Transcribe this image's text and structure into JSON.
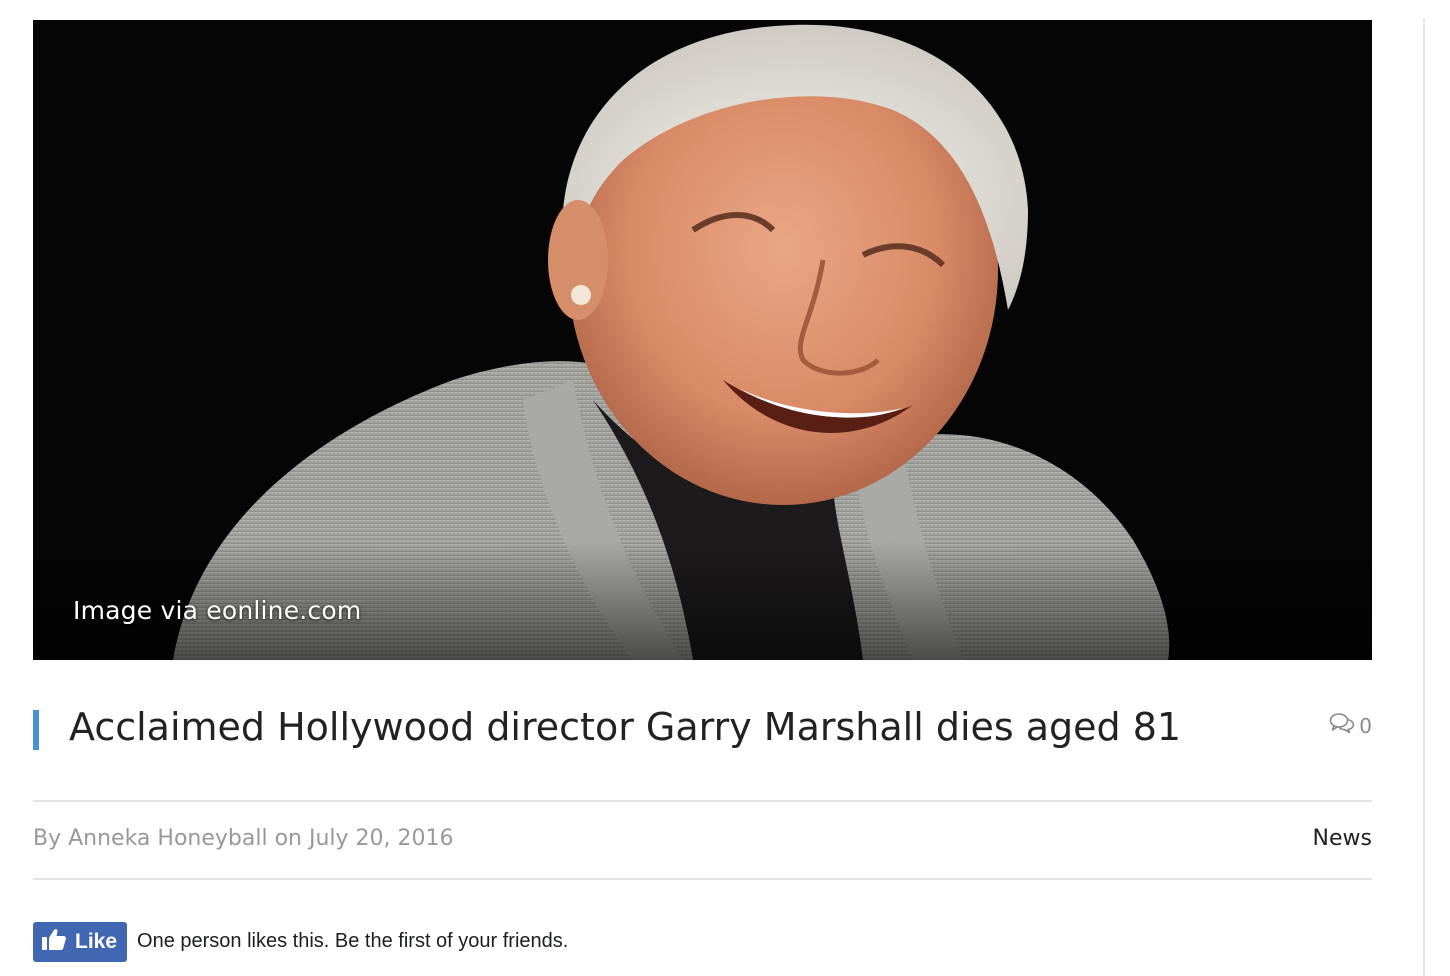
{
  "hero": {
    "caption": "Image via eonline.com"
  },
  "article": {
    "title": "Acclaimed Hollywood director Garry Marshall dies aged 81",
    "comment_count": "0",
    "byline_prefix": "By ",
    "author": "Anneka Honeyball",
    "date_prefix": " on ",
    "date": "July 20, 2016",
    "category": "News"
  },
  "facebook": {
    "like_label": "Like",
    "social_text": "One person likes this. Be the first of your friends."
  },
  "colors": {
    "accent_bar": "#4a90d9",
    "facebook_blue": "#4267b2",
    "meta_gray": "#999999",
    "title_text": "#222222"
  },
  "icons": {
    "comments": "comments-icon",
    "thumbs_up": "thumbs-up-icon"
  }
}
